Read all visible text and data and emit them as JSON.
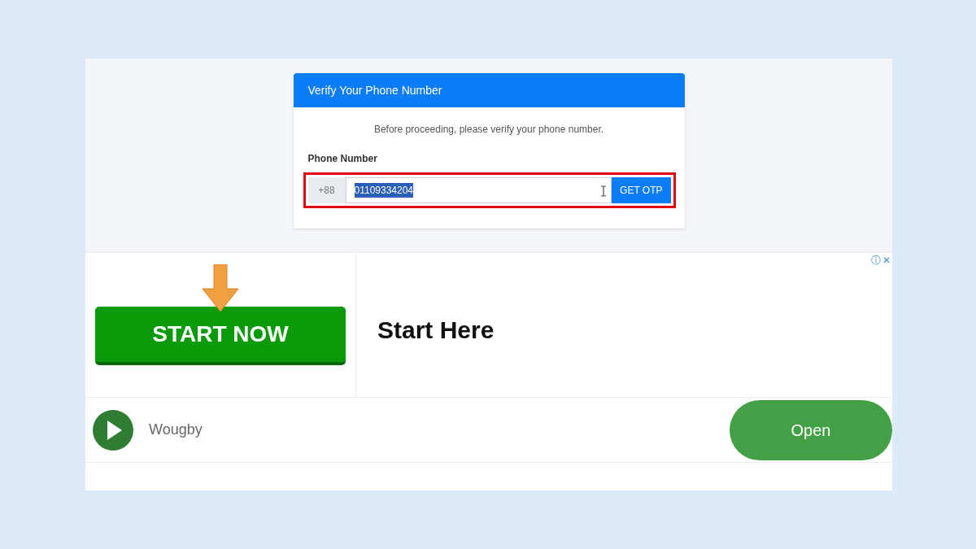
{
  "card": {
    "title": "Verify Your Phone Number",
    "message": "Before proceeding, please verify your phone number.",
    "field_label": "Phone Number",
    "prefix": "+88",
    "value": "01109334204",
    "value_selected": true,
    "outlined": true,
    "button": "GET OTP"
  },
  "ad": {
    "banner_button": "START NOW",
    "headline": "Start Here",
    "info": "ⓘ",
    "close": "✕",
    "app_name": "Wougby",
    "open_button": "Open"
  }
}
